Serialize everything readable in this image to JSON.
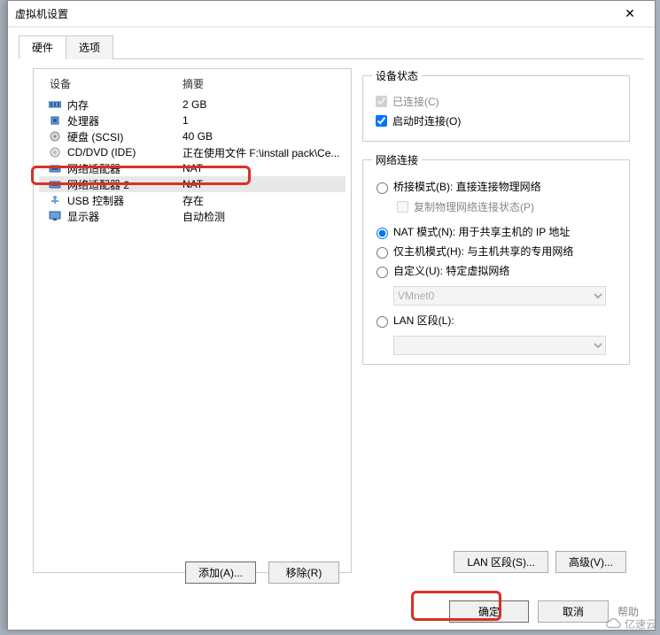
{
  "window": {
    "title": "虚拟机设置",
    "close": "✕"
  },
  "tabs": {
    "hardware": "硬件",
    "options": "选项"
  },
  "device_header": {
    "device": "设备",
    "summary": "摘要"
  },
  "devices": [
    {
      "icon": "memory",
      "name": "内存",
      "summary": "2 GB"
    },
    {
      "icon": "cpu",
      "name": "处理器",
      "summary": "1"
    },
    {
      "icon": "disk",
      "name": "硬盘 (SCSI)",
      "summary": "40 GB"
    },
    {
      "icon": "cd",
      "name": "CD/DVD (IDE)",
      "summary": "正在使用文件 F:\\install pack\\Ce..."
    },
    {
      "icon": "net",
      "name": "网络适配器",
      "summary": "NAT"
    },
    {
      "icon": "net",
      "name": "网络适配器 2",
      "summary": "NAT",
      "selected": true
    },
    {
      "icon": "usb",
      "name": "USB 控制器",
      "summary": "存在"
    },
    {
      "icon": "display",
      "name": "显示器",
      "summary": "自动检测"
    }
  ],
  "status": {
    "legend": "设备状态",
    "connected": "已连接(C)",
    "connect_on_power": "启动时连接(O)"
  },
  "netconn": {
    "legend": "网络连接",
    "bridged": "桥接模式(B): 直接连接物理网络",
    "replicate": "复制物理网络连接状态(P)",
    "nat": "NAT 模式(N): 用于共享主机的 IP 地址",
    "hostonly": "仅主机模式(H): 与主机共享的专用网络",
    "custom": "自定义(U): 特定虚拟网络",
    "custom_value": "VMnet0",
    "lan": "LAN 区段(L):",
    "lan_value": ""
  },
  "buttons": {
    "lan_seg": "LAN 区段(S)...",
    "advanced": "高级(V)...",
    "add": "添加(A)...",
    "remove": "移除(R)",
    "ok": "确定",
    "cancel": "取消",
    "help": "帮助"
  },
  "watermark": "亿速云"
}
